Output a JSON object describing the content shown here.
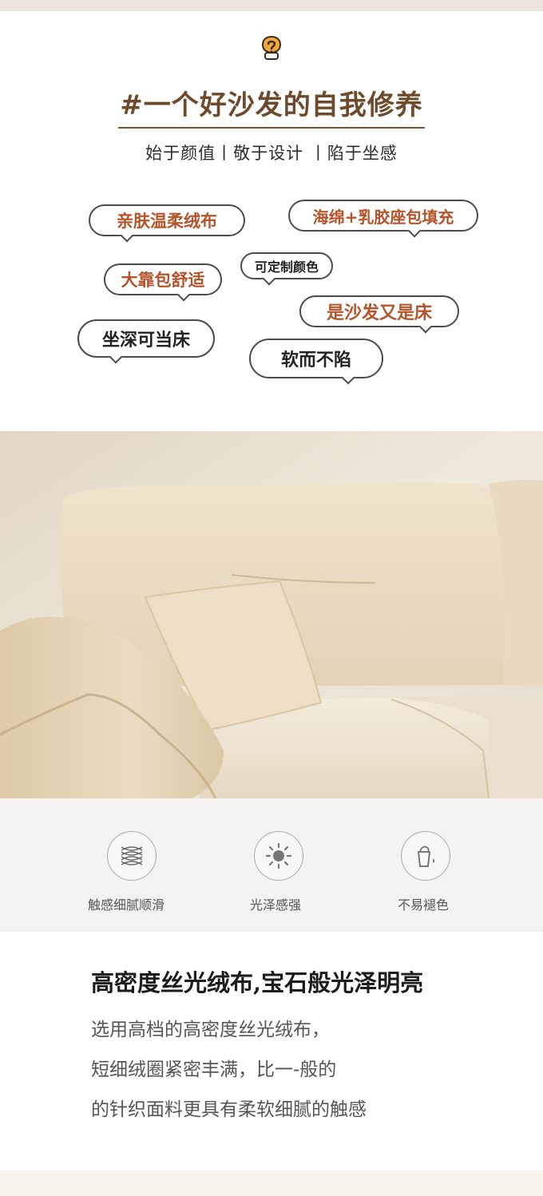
{
  "header": {
    "icon": "question-bubble-icon",
    "title": "#一个好沙发的自我修养",
    "subtitle": "始于颜值丨敬于设计 丨陷于坐感"
  },
  "bubbles": [
    {
      "text": "亲肤温柔绒布",
      "color": "#b5532a"
    },
    {
      "text": "海绵+乳胶座包填充",
      "color": "#b5532a"
    },
    {
      "text": "可定制颜色",
      "color": "#222222"
    },
    {
      "text": "大靠包舒适",
      "color": "#b5532a"
    },
    {
      "text": "是沙发又是床",
      "color": "#b5532a"
    },
    {
      "text": "坐深可当床",
      "color": "#222222"
    },
    {
      "text": "软而不陷",
      "color": "#222222"
    }
  ],
  "features": [
    {
      "icon": "fabric-weave-icon",
      "label": "触感细腻顺滑"
    },
    {
      "icon": "sun-icon",
      "label": "光泽感强"
    },
    {
      "icon": "dye-cup-icon",
      "label": "不易褪色"
    }
  ],
  "detail": {
    "heading": "高密度丝光绒布,宝石般光泽明亮",
    "lines": [
      "选用高档的高密度丝光绒布，",
      "短细绒圈紧密丰满，比一-般的",
      "的针织面料更具有柔软细腻的触感"
    ]
  }
}
